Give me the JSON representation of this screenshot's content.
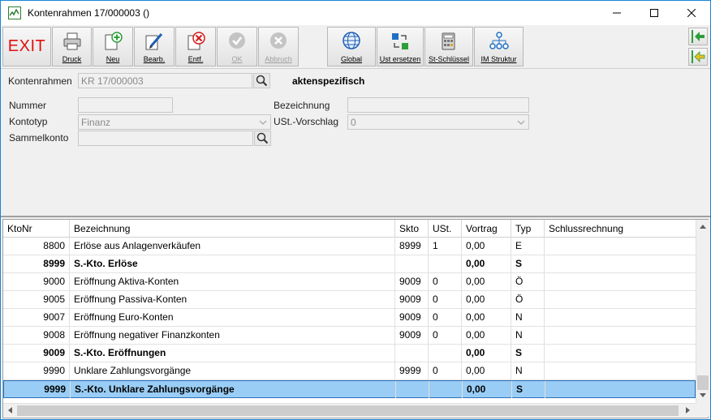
{
  "window": {
    "title": "Kontenrahmen 17/000003 ()",
    "controls": [
      "minimize-icon",
      "maximize-icon",
      "close-icon"
    ]
  },
  "toolbar": {
    "exit_label": "EXIT",
    "buttons": [
      {
        "label": "Druck",
        "icon": "printer-icon",
        "enabled": true
      },
      {
        "label": "Neu",
        "icon": "new-document-icon",
        "enabled": true
      },
      {
        "label": "Bearb.",
        "icon": "edit-pencil-icon",
        "enabled": true
      },
      {
        "label": "Entf.",
        "icon": "delete-icon",
        "enabled": true
      },
      {
        "label": "OK",
        "icon": "check-icon",
        "enabled": false
      },
      {
        "label": "Abbruch",
        "icon": "cancel-icon",
        "enabled": false
      },
      {
        "label": "Global",
        "icon": "globe-icon",
        "enabled": true
      },
      {
        "label": "Ust ersetzen",
        "icon": "replace-icon",
        "enabled": true
      },
      {
        "label": "St-Schlüssel",
        "icon": "calculator-icon",
        "enabled": true
      },
      {
        "label": "IM Struktur",
        "icon": "hierarchy-icon",
        "enabled": true
      }
    ],
    "nav_buttons": [
      "arrow-left-green-icon",
      "arrow-left-yellow-icon"
    ]
  },
  "form": {
    "kontenrahmen_label": "Kontenrahmen",
    "kontenrahmen_value": "KR 17/000003",
    "scope_label": "aktenspezifisch",
    "nummer_label": "Nummer",
    "nummer_value": "",
    "bezeichnung_label": "Bezeichnung",
    "bezeichnung_value": "",
    "kontotyp_label": "Kontotyp",
    "kontotyp_value": "Finanz",
    "ust_label": "USt.-Vorschlag",
    "ust_value": "0",
    "sammelkonto_label": "Sammelkonto",
    "sammelkonto_value": ""
  },
  "grid": {
    "columns": [
      "KtoNr",
      "Bezeichnung",
      "Skto",
      "USt.",
      "Vortrag",
      "Typ",
      "Schlussrechnung"
    ],
    "rows": [
      {
        "kto": "8800",
        "bez": "Erlöse aus Anlagenverkäufen",
        "skto": "8999",
        "ust": "1",
        "vortrag": "0,00",
        "typ": "E",
        "schluss": "",
        "bold": false,
        "selected": false
      },
      {
        "kto": "8999",
        "bez": "S.-Kto. Erlöse",
        "skto": "",
        "ust": "",
        "vortrag": "0,00",
        "typ": "S",
        "schluss": "",
        "bold": true,
        "selected": false
      },
      {
        "kto": "9000",
        "bez": "Eröffnung Aktiva-Konten",
        "skto": "9009",
        "ust": "0",
        "vortrag": "0,00",
        "typ": "Ö",
        "schluss": "",
        "bold": false,
        "selected": false
      },
      {
        "kto": "9005",
        "bez": "Eröffnung Passiva-Konten",
        "skto": "9009",
        "ust": "0",
        "vortrag": "0,00",
        "typ": "Ö",
        "schluss": "",
        "bold": false,
        "selected": false
      },
      {
        "kto": "9007",
        "bez": "Eröffnung Euro-Konten",
        "skto": "9009",
        "ust": "0",
        "vortrag": "0,00",
        "typ": "N",
        "schluss": "",
        "bold": false,
        "selected": false
      },
      {
        "kto": "9008",
        "bez": "Eröffnung negativer Finanzkonten",
        "skto": "9009",
        "ust": "0",
        "vortrag": "0,00",
        "typ": "N",
        "schluss": "",
        "bold": false,
        "selected": false
      },
      {
        "kto": "9009",
        "bez": "S.-Kto. Eröffnungen",
        "skto": "",
        "ust": "",
        "vortrag": "0,00",
        "typ": "S",
        "schluss": "",
        "bold": true,
        "selected": false
      },
      {
        "kto": "9990",
        "bez": "Unklare Zahlungsvorgänge",
        "skto": "9999",
        "ust": "0",
        "vortrag": "0,00",
        "typ": "N",
        "schluss": "",
        "bold": false,
        "selected": false
      },
      {
        "kto": "9999",
        "bez": "S.-Kto. Unklare Zahlungsvorgänge",
        "skto": "",
        "ust": "",
        "vortrag": "0,00",
        "typ": "S",
        "schluss": "",
        "bold": true,
        "selected": true
      }
    ]
  },
  "colors": {
    "exit_red": "#e01010",
    "selection_blue": "#99cdf5",
    "window_border": "#1883d7"
  }
}
